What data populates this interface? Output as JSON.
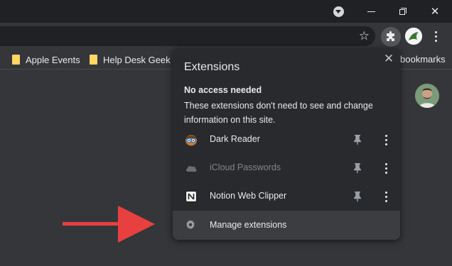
{
  "window": {
    "minimize_glyph": "",
    "close_glyph": "✕"
  },
  "toolbar": {
    "star_glyph": "☆"
  },
  "bookmarks": {
    "items": [
      {
        "label": "Apple Events"
      },
      {
        "label": "Help Desk Geek"
      }
    ],
    "other_label": "bookmarks"
  },
  "extensions_panel": {
    "title": "Extensions",
    "close_glyph": "✕",
    "section_heading": "No access needed",
    "section_description": "These extensions don't need to see and change information on this site.",
    "items": [
      {
        "name": "Dark Reader",
        "icon": "dark-reader-icon",
        "enabled": true
      },
      {
        "name": "iCloud Passwords",
        "icon": "icloud-icon",
        "enabled": false
      },
      {
        "name": "Notion Web Clipper",
        "icon": "notion-icon",
        "enabled": true
      }
    ],
    "manage_label": "Manage extensions"
  },
  "colors": {
    "title_bar": "#202124",
    "toolbar": "#35363a",
    "panel": "#292a2d",
    "manage_row": "#3c3d41",
    "folder": "#fdd663",
    "annotation_arrow": "#e8403f"
  }
}
